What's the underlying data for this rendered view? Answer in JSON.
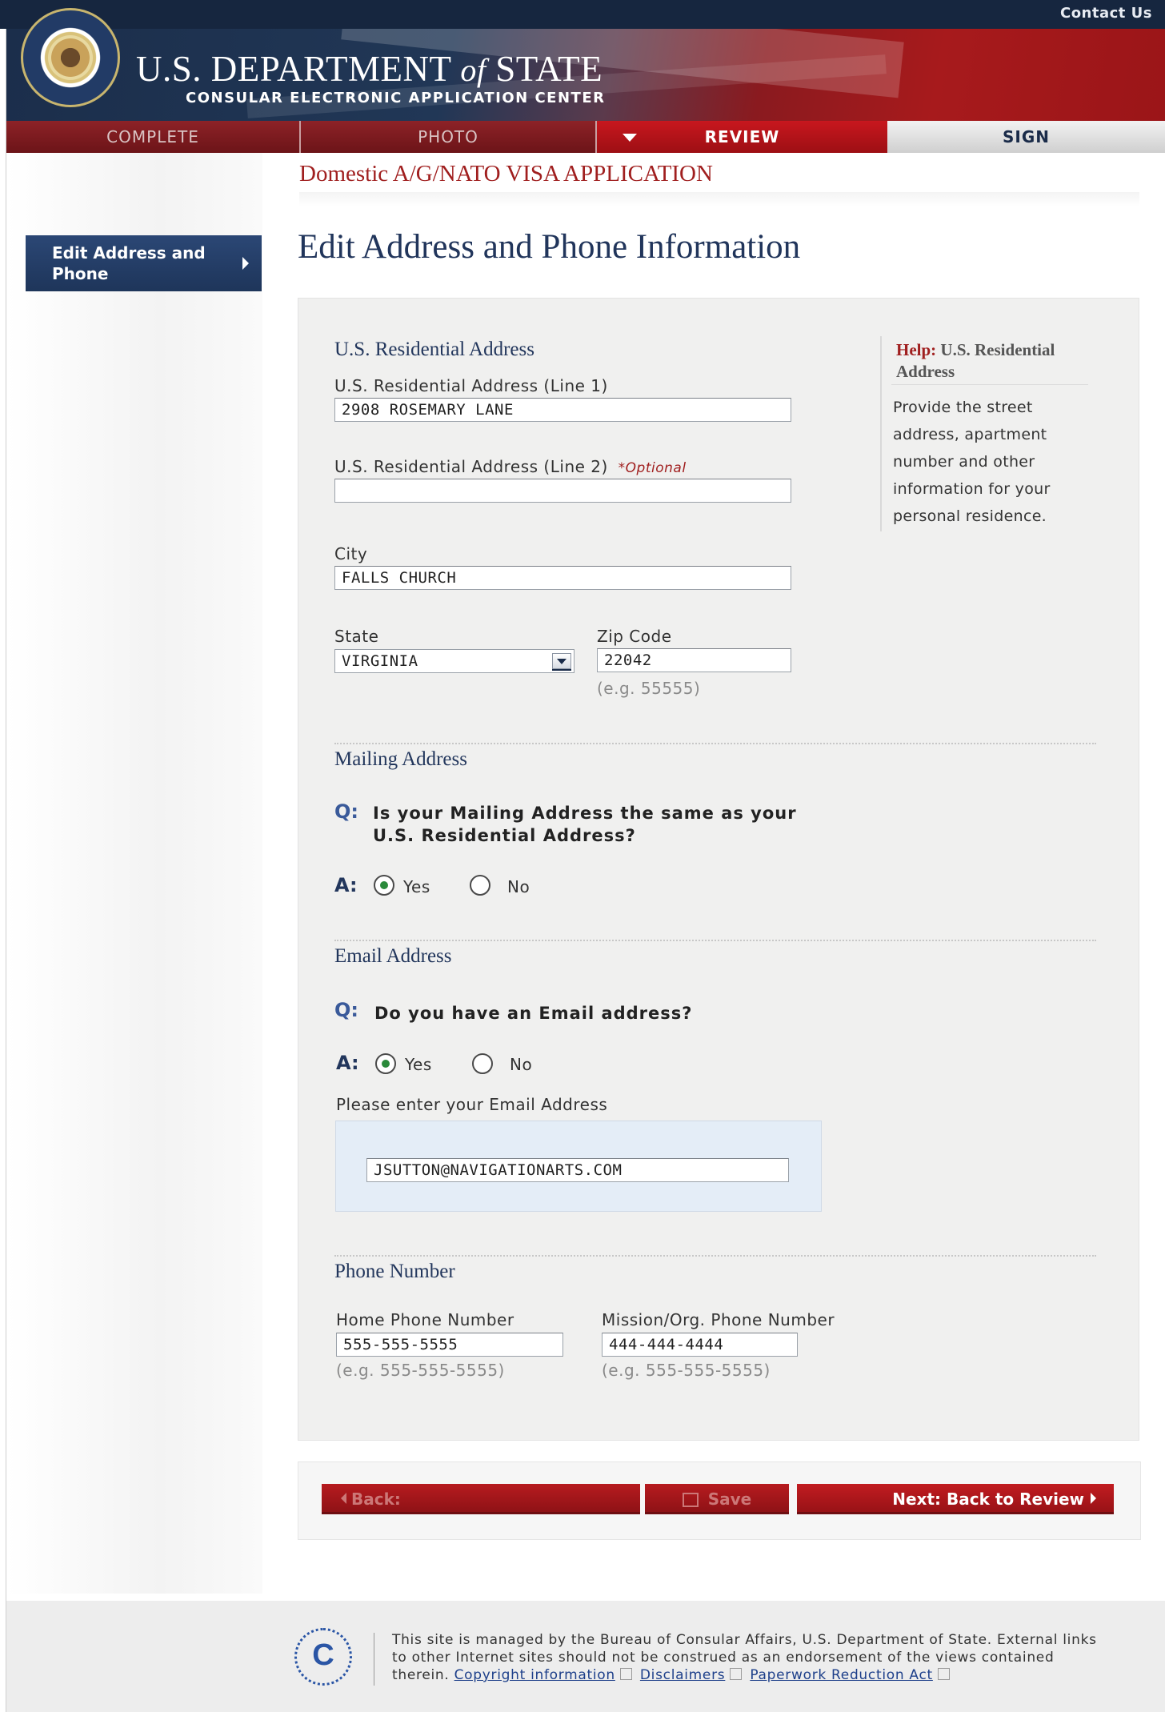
{
  "header": {
    "contact_link": "Contact Us",
    "dept_name_prefix": "U.S. DEPARTMENT",
    "dept_name_of": "of",
    "dept_name_suffix": "STATE",
    "dept_subtitle": "CONSULAR ELECTRONIC APPLICATION CENTER"
  },
  "nav": {
    "tabs": [
      {
        "label": "COMPLETE"
      },
      {
        "label": "PHOTO"
      },
      {
        "label": "REVIEW"
      },
      {
        "label": "SIGN"
      }
    ],
    "active_tab": "REVIEW"
  },
  "sidebar": {
    "items": [
      {
        "label": "Edit Address and Phone"
      }
    ]
  },
  "main": {
    "app_title": "Domestic A/G/NATO VISA APPLICATION",
    "page_title": "Edit Address and Phone Information"
  },
  "residential": {
    "heading": "U.S. Residential Address",
    "line1_label": "U.S. Residential Address (Line 1)",
    "line1_value": "2908 ROSEMARY LANE",
    "line2_label": "U.S. Residential Address (Line 2)",
    "line2_optional": "*Optional",
    "line2_value": "",
    "city_label": "City",
    "city_value": "FALLS CHURCH",
    "state_label": "State",
    "state_value": "VIRGINIA",
    "zip_label": "Zip Code",
    "zip_value": "22042",
    "zip_hint": "(e.g. 55555)"
  },
  "help": {
    "prefix": "Help:",
    "topic": "U.S. Residential Address",
    "text": "Provide the street address, apartment number and other information for your personal residence."
  },
  "mailing": {
    "heading": "Mailing Address",
    "q_mark": "Q:",
    "question": "Is your Mailing Address the same as your U.S. Residential Address?",
    "a_mark": "A:",
    "yes_label": "Yes",
    "no_label": "No",
    "selected": "Yes"
  },
  "email": {
    "heading": "Email Address",
    "q_mark": "Q:",
    "question": "Do you have an Email address?",
    "a_mark": "A:",
    "yes_label": "Yes",
    "no_label": "No",
    "selected": "Yes",
    "prompt": "Please enter your Email Address",
    "value": "JSUTTON@NAVIGATIONARTS.COM"
  },
  "phone": {
    "heading": "Phone Number",
    "home_label": "Home Phone Number",
    "home_value": "555-555-5555",
    "home_hint": "(e.g. 555-555-5555)",
    "mission_label": "Mission/Org. Phone Number",
    "mission_value": "444-444-4444",
    "mission_hint": "(e.g. 555-555-5555)"
  },
  "buttons": {
    "back": "Back:",
    "save": "Save",
    "next": "Next: Back to Review"
  },
  "footer": {
    "logo_letter": "C",
    "text": "This site is managed by the Bureau of Consular Affairs, U.S. Department of State. External links to other Internet sites should not be construed as an endorsement of the views contained therein.",
    "links": [
      "Copyright information",
      "Disclaimers",
      "Paperwork Reduction Act"
    ]
  },
  "colors": {
    "brand_navy": "#1e355a",
    "brand_red": "#a01f1f",
    "radio_selected": "#2a8a3a"
  }
}
